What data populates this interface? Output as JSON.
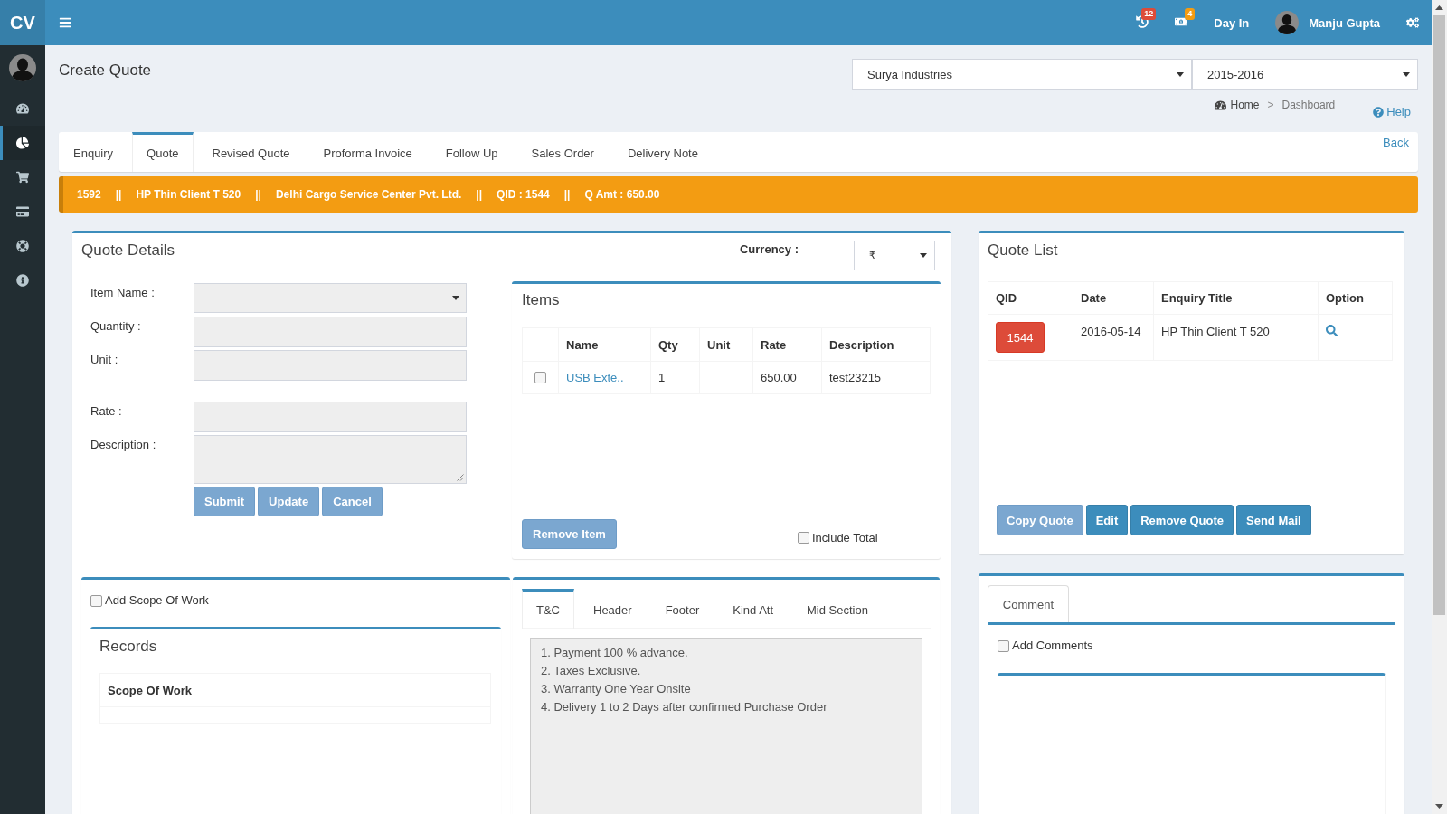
{
  "sidebar": {
    "logo": "CV",
    "items": [
      {
        "kind": "dashboard",
        "selected": false
      },
      {
        "kind": "chart",
        "selected": true
      },
      {
        "kind": "cart",
        "selected": false
      },
      {
        "kind": "card",
        "selected": false
      },
      {
        "kind": "support",
        "selected": false
      },
      {
        "kind": "info",
        "selected": false
      }
    ]
  },
  "topbar": {
    "items": [
      {
        "kind": "history",
        "badge": "12",
        "color": "#dd4b39"
      },
      {
        "kind": "money",
        "badge": "4",
        "color": "#f39c12"
      },
      {
        "kind": "link",
        "label": "Day In"
      },
      {
        "kind": "user",
        "label": "Manju Gupta"
      },
      {
        "kind": "settings"
      }
    ]
  },
  "page": {
    "title": "Create Quote",
    "company_select": {
      "value": "Surya Industries"
    },
    "year_select": {
      "value": "2015-2016"
    },
    "breadcrumb": [
      {
        "kind": "home",
        "label": "Home"
      },
      {
        "kind": "separator",
        "label": ">"
      },
      {
        "kind": "current",
        "label": "Dashboard"
      }
    ],
    "help": "Help",
    "tabs": [
      {
        "label": "Enquiry",
        "selected": false
      },
      {
        "label": "Quote",
        "selected": true
      },
      {
        "label": "Revised Quote",
        "selected": false
      },
      {
        "label": "Proforma Invoice",
        "selected": false
      },
      {
        "label": "Follow Up",
        "selected": false
      },
      {
        "label": "Sales Order",
        "selected": false
      },
      {
        "label": "Delivery Note",
        "selected": false
      }
    ],
    "back": "Back"
  },
  "info_bar": [
    {
      "kind": "field",
      "text": "1592"
    },
    {
      "kind": "separator",
      "text": "||"
    },
    {
      "kind": "field",
      "text": "HP Thin Client T 520"
    },
    {
      "kind": "separator",
      "text": "||"
    },
    {
      "kind": "field",
      "text": "Delhi Cargo Service Center Pvt. Ltd."
    },
    {
      "kind": "separator",
      "text": "||"
    },
    {
      "kind": "field",
      "text": "QID : 1544"
    },
    {
      "kind": "separator",
      "text": "||"
    },
    {
      "kind": "field",
      "text": "Q Amt : 650.00"
    }
  ],
  "quote_details": {
    "title": "Quote Details",
    "currency": {
      "label": "Currency :",
      "value": "₹"
    },
    "fields": [
      {
        "label": "Item Name :",
        "kind": "select",
        "disabled": true
      },
      {
        "label": "Quantity :",
        "kind": "input",
        "disabled": true
      },
      {
        "label": "Unit :",
        "kind": "input",
        "disabled": true
      },
      {
        "label": "Rate :",
        "kind": "input",
        "disabled": true
      },
      {
        "label": "Description :",
        "kind": "textarea",
        "disabled": true
      }
    ],
    "buttons": [
      {
        "label": "Submit",
        "disabled": true
      },
      {
        "label": "Update",
        "disabled": true
      },
      {
        "label": "Cancel",
        "disabled": true
      }
    ]
  },
  "items": {
    "title": "Items",
    "columns": [
      "Name",
      "Qty",
      "Unit",
      "Rate",
      "Description"
    ],
    "rows": [
      {
        "checked": false,
        "name": "USB Exte..",
        "qty": "1",
        "rate": "650.00",
        "description": "test23215"
      }
    ],
    "remove_button": {
      "label": "Remove Item",
      "disabled": true
    },
    "include_total": {
      "label": "Include Total",
      "checked": false
    }
  },
  "scope": {
    "add_scope": {
      "label": "Add Scope Of Work",
      "checked": false
    },
    "records": {
      "title": "Records",
      "columns": [
        "Scope Of Work"
      ]
    }
  },
  "terms": {
    "tabs": [
      {
        "label": "T&C",
        "selected": true
      },
      {
        "label": "Header",
        "selected": false
      },
      {
        "label": "Footer",
        "selected": false
      },
      {
        "label": "Kind Att",
        "selected": false
      },
      {
        "label": "Mid Section",
        "selected": false
      }
    ],
    "lines": [
      "1. Payment 100 % advance.",
      "2. Taxes Exclusive.",
      "3. Warranty One Year Onsite",
      "4. Delivery 1 to 2 Days after confirmed Purchase Order"
    ]
  },
  "quote_list": {
    "title": "Quote List",
    "columns": [
      "QID",
      "Date",
      "Enquiry Title",
      "Option"
    ],
    "rows": [
      {
        "qid": "1544",
        "date": "2016-05-14",
        "title": "HP Thin Client T 520"
      }
    ],
    "buttons": [
      {
        "label": "Copy Quote",
        "disabled": true
      },
      {
        "label": "Edit",
        "disabled": false
      },
      {
        "label": "Remove Quote",
        "disabled": false
      },
      {
        "label": "Send Mail",
        "disabled": false
      }
    ]
  },
  "comments": {
    "tabs": [
      {
        "label": "Comment",
        "selected": true
      }
    ],
    "add_comments": {
      "label": "Add Comments",
      "checked": false
    }
  }
}
